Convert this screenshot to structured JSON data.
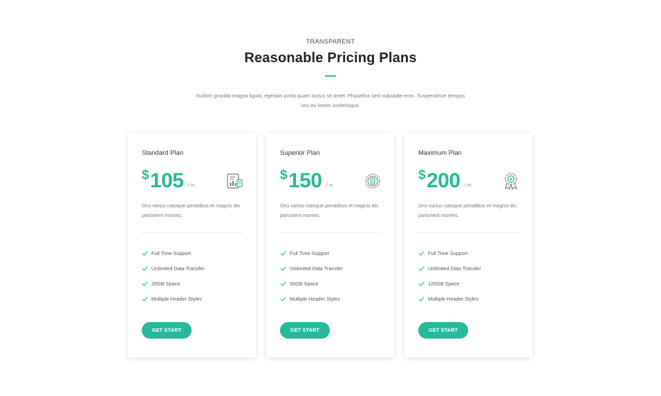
{
  "section": {
    "eyebrow": "TRANSPARENT",
    "title": "Reasonable Pricing Plans",
    "subtitle": "Nullam gravida magna ligula, egestas porta quam luctus sit amet. Phasellus sed vulputate eros. Suspendisse tempus orci eu lorem scelerisque.",
    "accent_color": "#26b99a"
  },
  "plans": [
    {
      "name": "Standard Plan",
      "currency": "$",
      "amount": "105",
      "period": "/ m",
      "icon": "report-chart-icon",
      "description": "Orci varius natoque penatibus et magnis dis parturient montes.",
      "features": [
        "Full Time Support",
        "Unlimited Data Transfer",
        "20GB Space",
        "Multiple Header Styles"
      ],
      "button": "GET START"
    },
    {
      "name": "Superior Plan",
      "currency": "$",
      "amount": "150",
      "period": "/ m",
      "icon": "gear-badge-icon",
      "description": "Orci varius natoque penatibus et magnis dis parturient montes.",
      "features": [
        "Full Time Support",
        "Unlimited Data Transfer",
        "50GB Space",
        "Multiple Header Styles"
      ],
      "button": "GET START"
    },
    {
      "name": "Maximum Plan",
      "currency": "$",
      "amount": "200",
      "period": "/ m",
      "icon": "award-ribbon-icon",
      "description": "Orci varius natoque penatibus et magnis dis parturient montes.",
      "features": [
        "Full Time Support",
        "Unlimited Data Transfer",
        "120GB Space",
        "Multiple Header Styles"
      ],
      "button": "GET START"
    }
  ]
}
